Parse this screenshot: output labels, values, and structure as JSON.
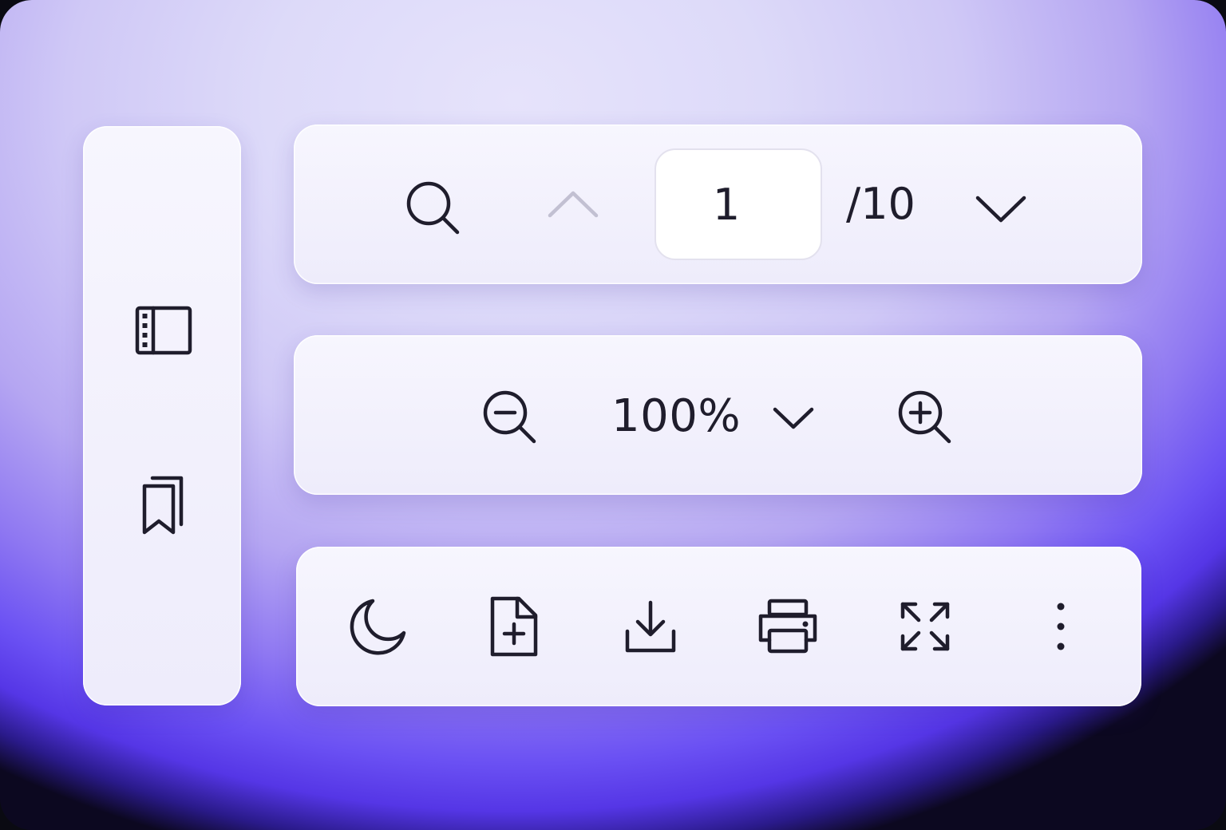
{
  "sidebar": {
    "items": [
      {
        "icon": "sidebar-panel-icon"
      },
      {
        "icon": "bookmarks-icon"
      }
    ]
  },
  "pager": {
    "search_icon": "search-icon",
    "prev_icon": "chevron-up-icon",
    "current_page": "1",
    "total_label": "/10",
    "next_icon": "chevron-down-icon"
  },
  "zoom": {
    "zoom_out_icon": "zoom-out-icon",
    "level": "100%",
    "dropdown_icon": "chevron-down-icon",
    "zoom_in_icon": "zoom-in-icon"
  },
  "tools": {
    "items": [
      {
        "icon": "moon-icon"
      },
      {
        "icon": "add-file-icon"
      },
      {
        "icon": "download-icon"
      },
      {
        "icon": "printer-icon"
      },
      {
        "icon": "fullscreen-icon"
      },
      {
        "icon": "more-vertical-icon"
      }
    ]
  },
  "colors": {
    "icon": "#1f1d2c",
    "icon_disabled": "#c2c0d2",
    "card": "#f3f2fd",
    "accent": "#6a50f3"
  }
}
